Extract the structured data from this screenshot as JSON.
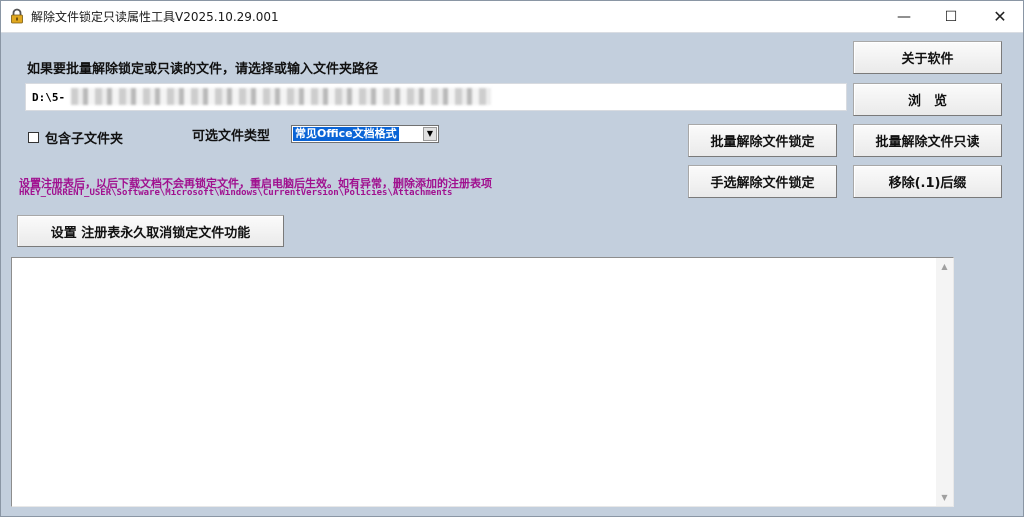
{
  "window": {
    "title": "解除文件锁定只读属性工具V2025.10.29.001",
    "icon": "padlock-icon",
    "controls": {
      "minimize": "—",
      "maximize": "☐",
      "close": "✕"
    }
  },
  "path_prompt": "如果要批量解除锁定或只读的文件，请选择或输入文件夹路径",
  "path_input": {
    "value": "D:\\5-"
  },
  "include_subfolders": {
    "label": "包含子文件夹",
    "checked": false
  },
  "file_type": {
    "label": "可选文件类型",
    "selected": "常见Office文档格式"
  },
  "buttons": {
    "about": "关于软件",
    "browse": "浏　览",
    "batch_unlock": "批量解除文件锁定",
    "batch_readonly": "批量解除文件只读",
    "manual_unlock": "手选解除文件锁定",
    "remove_suffix": "移除(.1)后缀",
    "registry_disable": "设置 注册表永久取消锁定文件功能"
  },
  "notice": {
    "line1": "设置注册表后，以后下载文档不会再锁定文件，重启电脑后生效。如有异常，删除添加的注册表项",
    "line2": "HKEY_CURRENT_USER\\Software\\Microsoft\\Windows\\CurrentVersion\\Policies\\Attachments"
  },
  "log": {
    "content": ""
  },
  "colors": {
    "window_bg": "#c3cfdd",
    "notice_text": "#a0108f",
    "select_highlight": "#0a64d6"
  }
}
